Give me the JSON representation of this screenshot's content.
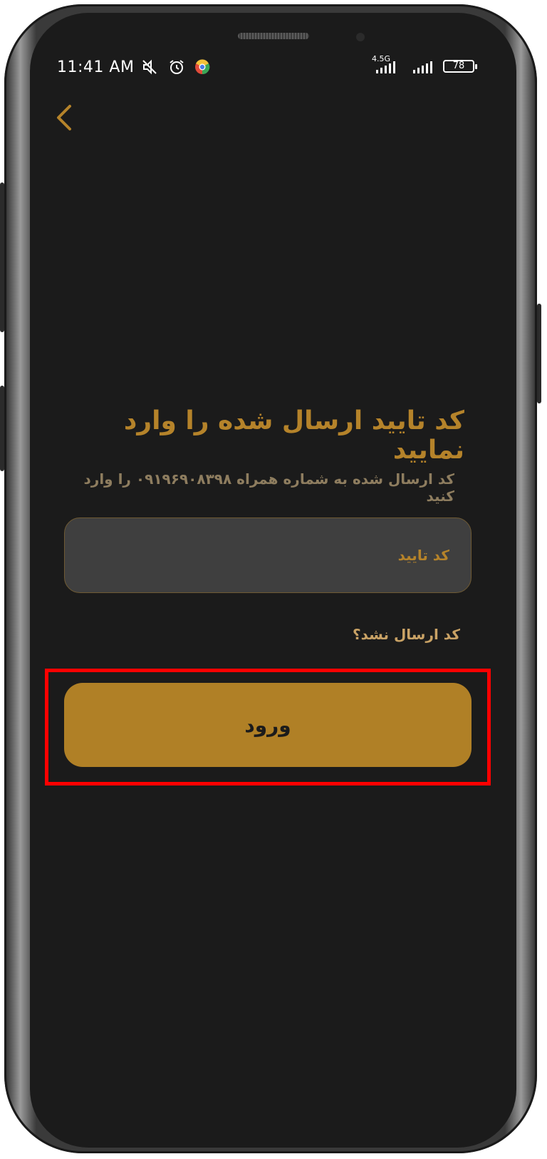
{
  "status_bar": {
    "time": "11:41 AM",
    "network_label": "4.5G",
    "battery": "78"
  },
  "verify": {
    "title": "کد تایید ارسال شده را وارد نمایید",
    "subtitle": "کد ارسال شده به شماره همراه ۰۹۱۹۶۹۰۸۳۹۸ را وارد کنید",
    "code_placeholder": "کد تایید",
    "resend_link": "کد ارسال نشد؟",
    "login_button": "ورود"
  },
  "colors": {
    "accent": "#b08026",
    "title_gold": "#b5832a",
    "screen_bg": "#1b1b1b",
    "input_bg": "#3f3f3f",
    "highlight": "#ff0000"
  },
  "icons": [
    "mute-icon",
    "alarm-icon",
    "chrome-icon",
    "signal-icon",
    "battery-icon",
    "back-chevron-icon"
  ]
}
